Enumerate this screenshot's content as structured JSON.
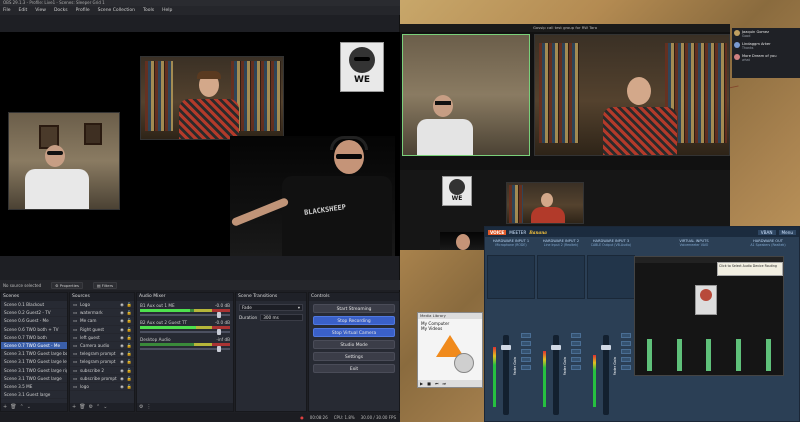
{
  "obs": {
    "title": "OBS 29.1.3 - Profile: Live1 - Scenes: Sleeper Grid 1",
    "menu": [
      "File",
      "Edit",
      "View",
      "Docks",
      "Profile",
      "Scene Collection",
      "Tools",
      "Help"
    ],
    "source_status": "No source selected",
    "properties_label": "Properties",
    "filters_label": "Filters",
    "scenes": {
      "title": "Scenes",
      "items": [
        {
          "label": "Scene 0.1 Blackout",
          "active": false
        },
        {
          "label": "Scene 0.2 Guest2 - TV",
          "active": false
        },
        {
          "label": "Scene 0.6 Guest - Me",
          "active": false
        },
        {
          "label": "Scene 0.6 TWO both + TV",
          "active": false
        },
        {
          "label": "Scene 0.7 TWO both",
          "active": false
        },
        {
          "label": "Scene 0.7 TWO Guest - Me",
          "active": true
        },
        {
          "label": "Scene 3.1 TWO Guest large both",
          "active": false
        },
        {
          "label": "Scene 3.1 TWO Guest large left",
          "active": false
        },
        {
          "label": "Scene 3.1 TWO Guest large right",
          "active": false
        },
        {
          "label": "Scene 3.1 TWO Guest large",
          "active": false
        },
        {
          "label": "Scene 3.5 ME",
          "active": false
        },
        {
          "label": "Scene 3.1 Guest large",
          "active": false
        }
      ]
    },
    "sources": {
      "title": "Sources",
      "items": [
        "Logo",
        "watermark",
        "Me cam",
        "Right guest",
        "left guest",
        "Camera audio",
        "telegram prompt",
        "telegram prompt",
        "subscribe 2",
        "subscribe prompt",
        "logo"
      ]
    },
    "mixer": {
      "title": "Audio Mixer",
      "channels": [
        {
          "name": "B1 Aux out 1 ME",
          "db": "-0.0 dB",
          "level": 0.55,
          "volume": 0.88
        },
        {
          "name": "B2 Aux out 2 Guest TT",
          "db": "-0.0 dB",
          "level": 0.62,
          "volume": 0.88
        },
        {
          "name": "Desktop Audio",
          "db": "-inf dB",
          "level": 0.0,
          "volume": 0.88
        }
      ]
    },
    "transitions": {
      "title": "Scene Transitions",
      "type": "Fade",
      "duration_label": "Duration",
      "duration_value": "300 ms"
    },
    "controls": {
      "title": "Controls",
      "buttons": [
        "Start Streaming",
        "Stop Recording",
        "Stop Virtual Camera",
        "Studio Mode",
        "Settings",
        "Exit"
      ]
    },
    "status": {
      "rec_time": "00:08:26",
      "cpu": "CPU: 1.8%",
      "fps": "30.00 / 30.00 FPS"
    },
    "logo_text": "WE"
  },
  "zoom": {
    "title": "Gossip call test group for RW Taro"
  },
  "chat": [
    {
      "name": "Jaaquin Gomez",
      "text": "Good",
      "color": "#c0a060"
    },
    {
      "name": "Lindaggm Arker",
      "text": "Thanks",
      "color": "#7a9ad0"
    },
    {
      "name": "More Dream of you",
      "text": "what",
      "color": "#d08080"
    }
  ],
  "explorer": {
    "title": "Media Library",
    "items": [
      "My Computer",
      "My Videos"
    ]
  },
  "voicemeeter": {
    "brand": "VOICE",
    "brand_rest": "MEETER",
    "edition": "Banana",
    "inputs": [
      {
        "title": "HARDWARE INPUT 1",
        "sub": "Microphone (RODE)"
      },
      {
        "title": "HARDWARE INPUT 2",
        "sub": "Line Input 2 (Realtek)"
      },
      {
        "title": "HARDWARE INPUT 3",
        "sub": "CABLE Output (VB-Audio)"
      },
      {
        "title": "VIRTUAL INPUTS",
        "sub": "Voicemeeter VAIO"
      },
      {
        "title": "HARDWARE OUT",
        "sub": "A1 Speakers (Realtek)"
      }
    ],
    "fader_label": "Fader Gain",
    "menu_label": "Menu",
    "vban_label": "VBAN",
    "notice": "Click to Select Audio Device Routing"
  },
  "colors": {
    "obs_bg": "#1e1f24",
    "obs_accent": "#3a60c8",
    "voicemeeter_bg": "#2b3f55",
    "rec_red": "#e04040"
  }
}
